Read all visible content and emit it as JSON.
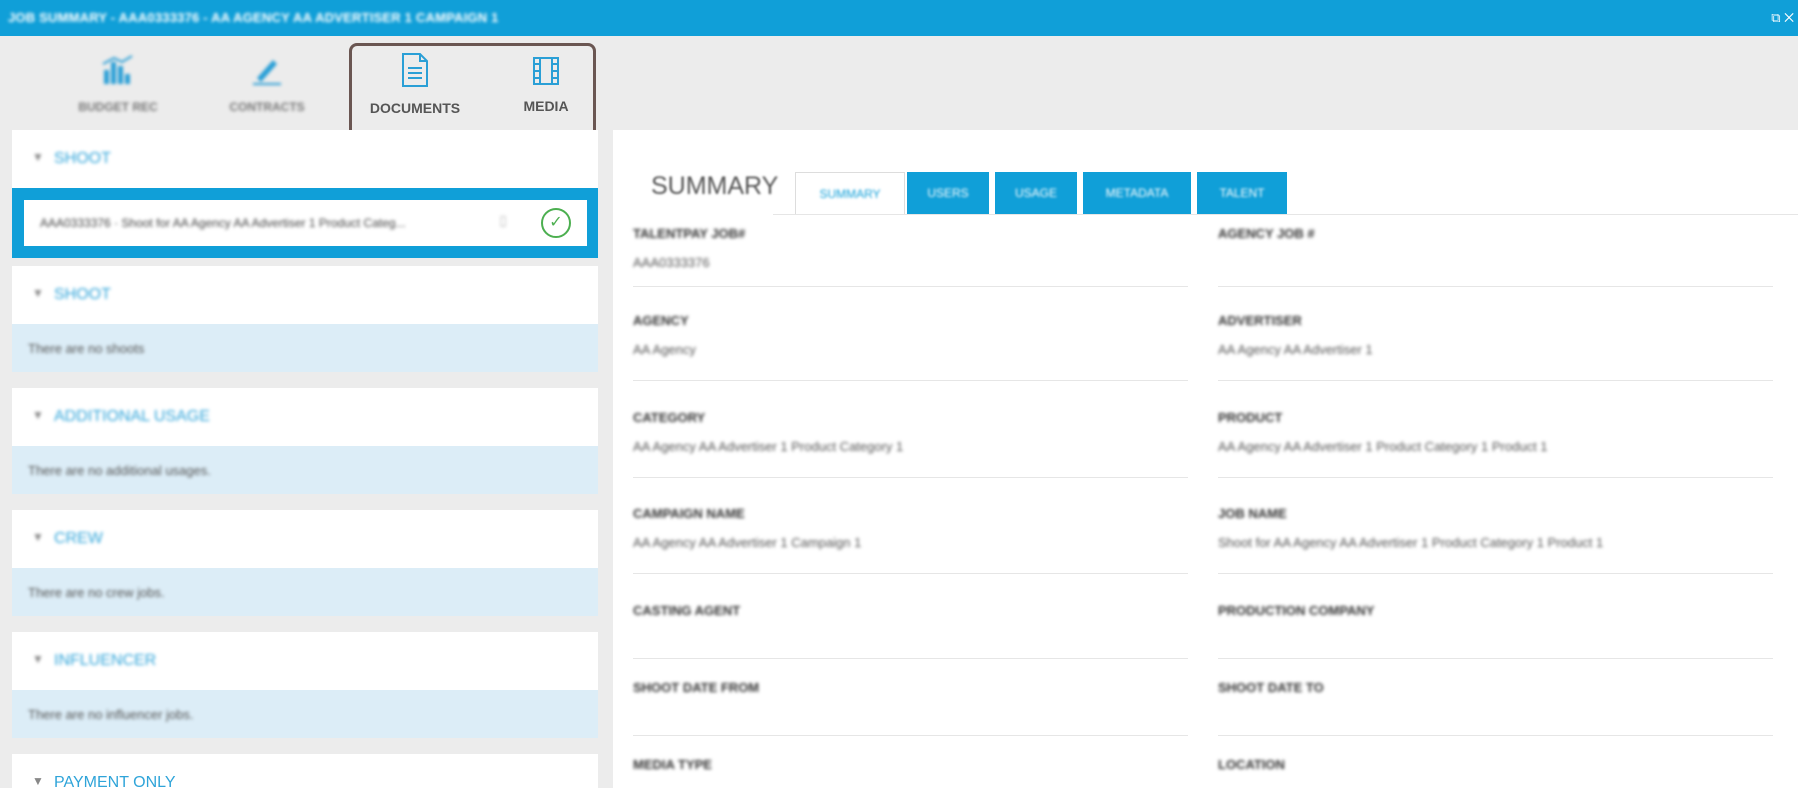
{
  "topbar": {
    "title": "JOB SUMMARY - AAA0333376 - AA AGENCY AA ADVERTISER 1 CAMPAIGN 1",
    "icons": "⧉ ✕"
  },
  "toolbar": {
    "items": [
      {
        "label": "BUDGET REC",
        "icon": "budget-chart-icon"
      },
      {
        "label": "CONTRACTS",
        "icon": "contract-pen-icon"
      },
      {
        "label": "DOCUMENTS",
        "icon": "document-icon"
      },
      {
        "label": "MEDIA",
        "icon": "film-icon"
      }
    ]
  },
  "left": {
    "sections": [
      {
        "title": "SHOOT",
        "selected": "AAA0333376 · Shoot for AA Agency AA Advertiser 1 Product Categ..."
      },
      {
        "title": "SHOOT",
        "empty": "There are no shoots"
      },
      {
        "title": "ADDITIONAL USAGE",
        "empty": "There are no additional usages."
      },
      {
        "title": "CREW",
        "empty": "There are no crew jobs."
      },
      {
        "title": "INFLUENCER",
        "empty": "There are no influencer jobs."
      },
      {
        "title": "PAYMENT ONLY"
      }
    ]
  },
  "summary": {
    "heading": "SUMMARY",
    "tabs": [
      "SUMMARY",
      "USERS",
      "USAGE",
      "METADATA",
      "TALENT"
    ],
    "fields": [
      {
        "label": "TALENTPAY JOB#",
        "value": "AAA0333376"
      },
      {
        "label": "AGENCY JOB #",
        "value": ""
      },
      {
        "label": "AGENCY",
        "value": "AA Agency"
      },
      {
        "label": "ADVERTISER",
        "value": "AA Agency AA Advertiser 1"
      },
      {
        "label": "CATEGORY",
        "value": "AA Agency AA Advertiser 1 Product Category 1"
      },
      {
        "label": "PRODUCT",
        "value": "AA Agency AA Advertiser 1 Product Category 1 Product 1"
      },
      {
        "label": "CAMPAIGN NAME",
        "value": "AA Agency AA Advertiser 1 Campaign 1"
      },
      {
        "label": "JOB NAME",
        "value": "Shoot for AA Agency AA Advertiser 1 Product Category 1 Product 1"
      },
      {
        "label": "CASTING AGENT",
        "value": ""
      },
      {
        "label": "PRODUCTION COMPANY",
        "value": ""
      },
      {
        "label": "SHOOT DATE FROM",
        "value": ""
      },
      {
        "label": "SHOOT DATE TO",
        "value": ""
      },
      {
        "label": "MEDIA TYPE",
        "value": ""
      },
      {
        "label": "LOCATION",
        "value": ""
      }
    ]
  },
  "colors": {
    "accent": "#109fd8",
    "highlight": "#6a5652",
    "success": "#4caf50"
  }
}
